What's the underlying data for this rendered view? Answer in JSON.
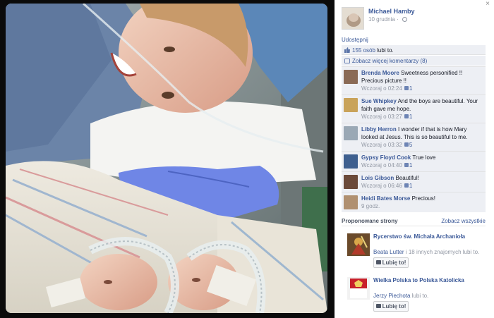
{
  "window": {
    "close_glyph": "×"
  },
  "author": {
    "name": "Michael Hamby",
    "date": "10 grudnia",
    "date_separator": "·",
    "privacy_icon": "globe-icon"
  },
  "actions": {
    "share": "Udostępnij"
  },
  "likes": {
    "count_link": "155 osób",
    "suffix": " lubi to."
  },
  "more_comments": {
    "label": "Zobacz więcej komentarzy (8)"
  },
  "comments": [
    {
      "name": "Brenda Moore",
      "text": " Sweetness personified !! Precious picture !!",
      "time": "Wczoraj o 02:24",
      "likes": "1",
      "avatar_color": "#8a6a55"
    },
    {
      "name": "Sue Whipkey",
      "text": " And the boys are beautiful. Your faith gave me hope.",
      "time": "Wczoraj o 03:27",
      "likes": "1",
      "avatar_color": "#c9a35a"
    },
    {
      "name": "Libby Herron",
      "text": " I wonder if that is how Mary looked at Jesus. This is so beautiful to me.",
      "time": "Wczoraj o 03:32",
      "likes": "5",
      "avatar_color": "#9aa8b5"
    },
    {
      "name": "Gypsy Floyd Cook",
      "text": " True love",
      "time": "Wczoraj o 04:40",
      "likes": "1",
      "avatar_color": "#3e5f8f"
    },
    {
      "name": "Lois Gibson",
      "text": " Beautiful!",
      "time": "Wczoraj o 06:46",
      "likes": "1",
      "avatar_color": "#6b4a3a"
    },
    {
      "name": "Heidi Bates Morse",
      "text": " Precious!",
      "time": "9 godz.",
      "likes": "",
      "avatar_color": "#b09070"
    }
  ],
  "suggested": {
    "title": "Proponowane strony",
    "see_all": "Zobacz wszystkie",
    "pages": [
      {
        "name": "Rycerstwo św. Michała Archanioła",
        "friend": "Beata Lutter",
        "rest": " i 18 innych znajomych lubi to.",
        "button": "Lubię to!"
      },
      {
        "name": "Wielka Polska to Polska Katolicka",
        "friend": "Jerzy Piechota",
        "rest": " lubi to.",
        "button": "Lubię to!"
      }
    ]
  },
  "photo": {
    "alt_icon": "photo"
  }
}
